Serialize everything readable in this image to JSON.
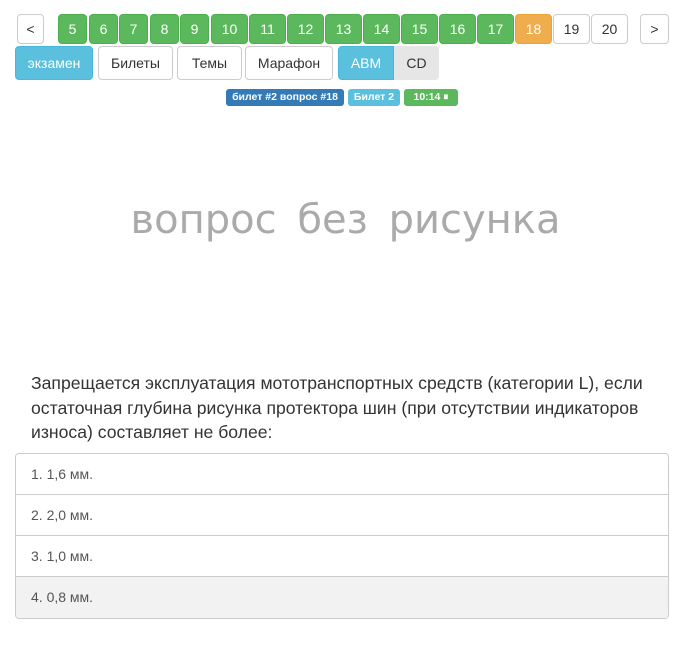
{
  "pager": {
    "prev": "<",
    "next": ">",
    "pages": [
      "5",
      "6",
      "7",
      "8",
      "9",
      "10",
      "11",
      "12",
      "13",
      "14",
      "15",
      "16",
      "17",
      "18",
      "19",
      "20"
    ]
  },
  "modes": {
    "exam": "экзамен",
    "tickets": "Билеты",
    "topics": "Темы",
    "marathon": "Марафон",
    "cat_abm": "ABM",
    "cat_cd": "CD"
  },
  "labels": {
    "ticket_question": "билет #2 вопрос #18",
    "ticket": "Билет 2",
    "timer": "10:14 ⏸"
  },
  "no_image_text": "вопрос без рисунка",
  "question": "Запрещается эксплуатация мототранспортных средств (категории L), если остаточная глубина рисунка протектора шин (при отсутствии индикаторов износа) составляет не более:",
  "answers": [
    "1. 1,6 мм.",
    "2. 2,0 мм.",
    "3. 1,0 мм.",
    "4. 0,8 мм."
  ],
  "colors": {
    "answered": "#5cb85c",
    "current": "#f0ad4e",
    "primary": "#5bc0de",
    "label_blue": "#337ab7"
  }
}
